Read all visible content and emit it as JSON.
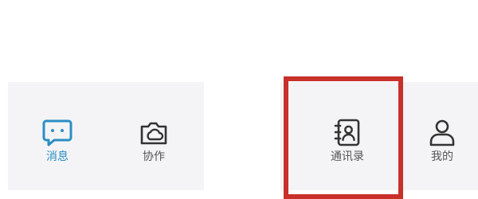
{
  "tabbar": {
    "tabs": [
      {
        "id": "messages",
        "label": "消息",
        "icon": "message-icon",
        "active": true
      },
      {
        "id": "collab",
        "label": "协作",
        "icon": "cloud-folder-icon",
        "active": false
      },
      {
        "id": "contacts",
        "label": "通讯录",
        "icon": "contacts-book-icon",
        "active": false
      },
      {
        "id": "me",
        "label": "我的",
        "icon": "person-icon",
        "active": false
      }
    ]
  },
  "colors": {
    "active": "#2a8ec4",
    "inactive": "#555555",
    "tabbar_bg": "#f4f4f6",
    "highlight": "#c8302a"
  }
}
